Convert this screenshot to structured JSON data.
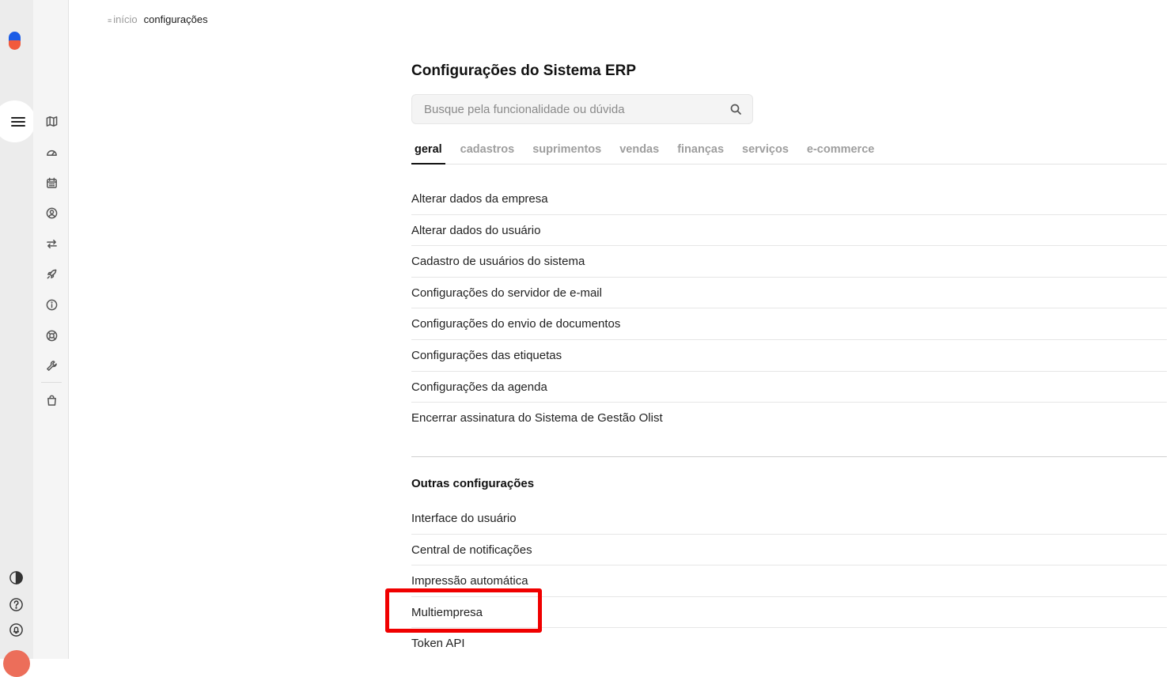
{
  "breadcrumb": {
    "home_icon": "menu-lines-icon",
    "home": "início",
    "current": "configurações"
  },
  "page": {
    "title": "Configurações do Sistema ERP"
  },
  "search": {
    "placeholder": "Busque pela funcionalidade ou dúvida",
    "icon": "search-icon"
  },
  "tabs": [
    {
      "label": "geral",
      "active": true
    },
    {
      "label": "cadastros",
      "active": false
    },
    {
      "label": "suprimentos",
      "active": false
    },
    {
      "label": "vendas",
      "active": false
    },
    {
      "label": "finanças",
      "active": false
    },
    {
      "label": "serviços",
      "active": false
    },
    {
      "label": "e-commerce",
      "active": false
    }
  ],
  "general_items": [
    "Alterar dados da empresa",
    "Alterar dados do usuário",
    "Cadastro de usuários do sistema",
    "Configurações do servidor de e-mail",
    "Configurações do envio de documentos",
    "Configurações das etiquetas",
    "Configurações da agenda",
    "Encerrar assinatura do Sistema de Gestão Olist"
  ],
  "other": {
    "title": "Outras configurações",
    "items": [
      "Interface do usuário",
      "Central de notificações",
      "Impressão automática",
      "Multiempresa",
      "Token API"
    ]
  },
  "highlighted_item": "Multiempresa",
  "colors": {
    "accent": "#111111",
    "muted": "#9e9e9e",
    "highlight": "#f00000",
    "logo_blue": "#1b5ce6",
    "logo_orange": "#f25a3c"
  },
  "sidebar_icons": [
    "map-icon",
    "dashboard-icon",
    "calendar-icon",
    "user-icon",
    "transfer-icon",
    "rocket-icon",
    "info-icon",
    "support-icon",
    "wrench-icon",
    "shopping-bag-icon"
  ],
  "bottom_icons": [
    "contrast-icon",
    "help-icon",
    "bell-icon"
  ]
}
